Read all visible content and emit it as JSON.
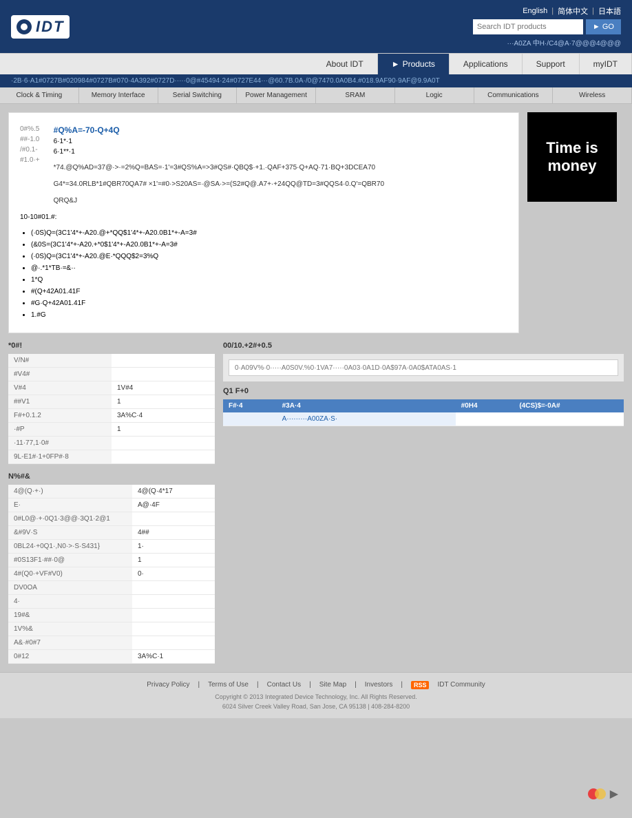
{
  "header": {
    "logo_text": "IDT",
    "lang_items": [
      "English",
      "简体中文",
      "日本語"
    ],
    "search_placeholder": "Search IDT products",
    "go_label": "GO",
    "account_label": "···A0ZA 中H·/C4@A·7@@@4@@@"
  },
  "nav": {
    "items": [
      {
        "label": "About IDT",
        "active": false
      },
      {
        "label": "Products",
        "active": true
      },
      {
        "label": "Applications",
        "active": false
      },
      {
        "label": "Support",
        "active": false
      },
      {
        "label": "myIDT",
        "active": false
      }
    ]
  },
  "breadcrumb": {
    "text": "·2B·6·A1#0727B#020984#0727B#070·4A392#0727D·····0@#45494·24#0727E44···@60.7B.0A·/0@7470.0A0B4.#018.9AF90·9AF@9.9A0T"
  },
  "category_nav": {
    "items": [
      "Clock & Timing",
      "Memory Interface",
      "Serial Switching",
      "Power Management",
      "SRAM",
      "Logic",
      "Communications",
      "Wireless"
    ]
  },
  "product": {
    "meta": [
      {
        "label": "0#%.5",
        "value": ""
      },
      {
        "label": "##-1.0",
        "value": ""
      },
      {
        "label": "/#0.1-",
        "value": ""
      },
      {
        "label": "#1.0·+",
        "value": ""
      }
    ],
    "title": "#Q%A=-70-Q+4Q",
    "subtitle": "6·1*·1",
    "description1": "*74.@Q%AD=37@·>·=2%Q=BAS=·1'=3#QS%A=>3#QS#·QBQ$·+1.·QAF+375·Q+AQ·71·BQ+3DCEA70",
    "description2": "G4*=34.0RLB*1#QBR70QA7# ×1'=#0·>S20AS=·@SA·>=(S2#Q@.A7+·+24QQ@TD=3#QQS4·0.Q'=QBR70",
    "description3": "QRQ&J",
    "list_title": "10-10#01.#:",
    "list_items": [
      "(·0S)Q=(3C1'4*+-A20.@+*QQ$1'4*+-A20.0B1*+-A=3#",
      "(&0S=(3C1'4*+-A20.+*0$1'4*+-A20.0B1*+-A=3#",
      "(·0S)Q=(3C1'4*+-A20.@E·*QQQ$2=3%Q",
      "@·.*1*TB·=&··",
      "1*Q",
      "#(Q+42A01.41F",
      "#G·Q+42A01.41F",
      "1.#G"
    ]
  },
  "ad": {
    "line1": "Time is",
    "line2": "money"
  },
  "order_section": {
    "title": "*0#!",
    "fields": [
      {
        "label": "V/N#",
        "value": ""
      },
      {
        "label": "#V4#",
        "value": ""
      },
      {
        "label": "V#4",
        "value": ""
      },
      {
        "label": "##V1",
        "value": "1"
      },
      {
        "label": "F#+0.1.2",
        "value": "3A%C·4"
      },
      {
        "label": "·#P",
        "value": "1"
      },
      {
        "label": "·11·77,1·0#",
        "value": ""
      },
      {
        "label": "9L-E1#·1+0FP#·8",
        "value": ""
      }
    ]
  },
  "search_section": {
    "title": "00/10.+2#+0.5",
    "placeholder": "0·A09V%·0·····A0S0V.%0·1VA7·····0A03·0A1D·0A$97A·0A0$ATA0AS·1"
  },
  "results_section": {
    "title": "Q1 F+0",
    "columns": [
      "F#·4",
      "#3A·4",
      "#0H4",
      "(4CS)$=·0A#"
    ],
    "rows": [
      [
        "",
        "A·········A00ZA·S·",
        "",
        ""
      ]
    ]
  },
  "pricing_section": {
    "title": "N%#&",
    "fields": [
      {
        "label": "4@(Q·+·)",
        "value": "4@(Q·4*17"
      },
      {
        "label": "E·",
        "value": "A@·4F"
      },
      {
        "label": "0#L0@·+·0Q1·3@@·3Q1·2@1",
        "value": ""
      },
      {
        "label": "&#9V·S",
        "value": "4##"
      },
      {
        "label": "0BL24·+0Q1·,N0·>·S·S431}",
        "value": "1·"
      },
      {
        "label": "#0S13F1·##·0@",
        "value": "1"
      },
      {
        "label": "4#(Q0·+VF#V0)",
        "value": "0·"
      },
      {
        "label": "DV0OA",
        "value": ""
      },
      {
        "label": "4·",
        "value": ""
      },
      {
        "label": "19#&",
        "value": ""
      },
      {
        "label": "1V%&",
        "value": ""
      },
      {
        "label": "A&·#0#7",
        "value": ""
      },
      {
        "label": "0#12",
        "value": "3A%C·1"
      }
    ]
  },
  "footer": {
    "links": [
      "Privacy Policy",
      "Terms of Use",
      "Contact Us",
      "Site Map",
      "Investors",
      "RSS",
      "IDT Community"
    ],
    "copyright": "Copyright © 2013 Integrated Device Technology, Inc. All Rights Reserved.",
    "address": "6024 Silver Creek Valley Road, San Jose, CA 95138 | 408-284-8200"
  }
}
